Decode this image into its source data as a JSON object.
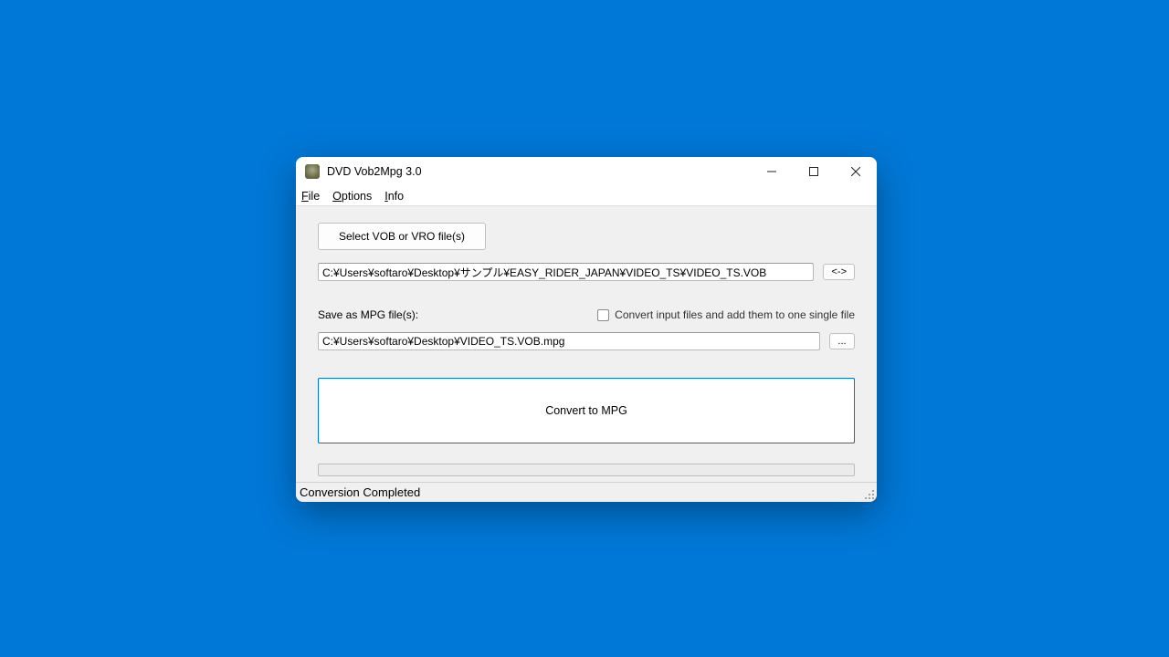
{
  "window": {
    "title": "DVD Vob2Mpg 3.0"
  },
  "menu": {
    "file": "File",
    "options": "Options",
    "info": "Info"
  },
  "main": {
    "select_button": "Select VOB or VRO file(s)",
    "input_path": "C:¥Users¥softaro¥Desktop¥サンプル¥EASY_RIDER_JAPAN¥VIDEO_TS¥VIDEO_TS.VOB",
    "swap_button": "<->",
    "save_label": "Save as MPG file(s):",
    "merge_checkbox_label": "Convert input files and add them to one single file",
    "merge_checked": false,
    "output_path": "C:¥Users¥softaro¥Desktop¥VIDEO_TS.VOB.mpg",
    "browse_button": "...",
    "convert_button": "Convert to MPG"
  },
  "status": {
    "text": "Conversion Completed"
  }
}
